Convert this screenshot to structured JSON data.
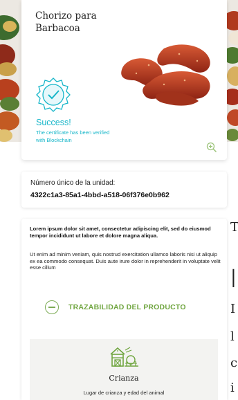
{
  "product": {
    "title": "Chorizo para Barbacoa",
    "success_title": "Success!",
    "success_text": "The certificate has been verified with Blockchain"
  },
  "unit": {
    "label": "Número único de la unidad:",
    "id": "4322c1a3-85a1-4bbd-a518-06f376e0b962"
  },
  "description": {
    "bold": "Lorem ipsum dolor sit amet, consectetur adipiscing elit, sed do eiusmod tempor incididunt ut labore et dolore magna aliqua.",
    "normal": "Ut enim ad minim veniam, quis nostrud exercitation ullamco laboris nisi ut aliquip ex ea commodo consequat. Duis aute irure dolor in reprehenderit in voluptate velit esse cillum"
  },
  "traceability": {
    "toggle_label": "TRAZABILIDAD DEL PRODUCTO",
    "stage_title": "Crianza",
    "stage_desc": "Lugar de crianza y edad del animal"
  },
  "peek_chars": [
    "T",
    "|",
    "I",
    "l",
    "c",
    "i"
  ],
  "colors": {
    "success": "#16b6c9",
    "accent_green": "#6fa53f",
    "sausage": "#b43a1f"
  },
  "icons": [
    "check-badge-icon",
    "zoom-in-icon",
    "minus-circle-icon",
    "farm-icon",
    "sausage-image"
  ]
}
